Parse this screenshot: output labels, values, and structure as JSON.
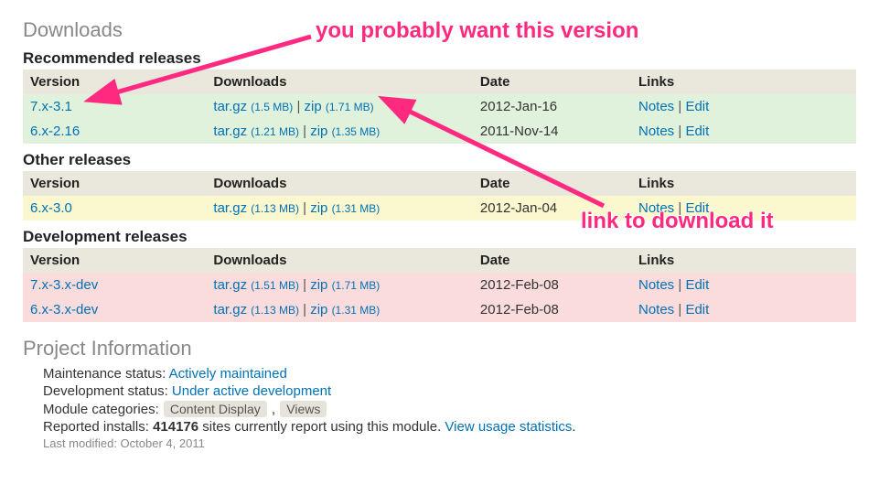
{
  "headings": {
    "downloads": "Downloads",
    "recommended": "Recommended releases",
    "other": "Other releases",
    "development": "Development releases",
    "project_info": "Project Information"
  },
  "columns": {
    "version": "Version",
    "downloads": "Downloads",
    "date": "Date",
    "links": "Links"
  },
  "separator": " | ",
  "links": {
    "notes": "Notes",
    "edit": "Edit"
  },
  "recommended": [
    {
      "version": "7.x-3.1",
      "tgz": "tar.gz",
      "tgz_size": "(1.5 MB)",
      "zip": "zip",
      "zip_size": "(1.71 MB)",
      "date": "2012-Jan-16"
    },
    {
      "version": "6.x-2.16",
      "tgz": "tar.gz",
      "tgz_size": "(1.21 MB)",
      "zip": "zip",
      "zip_size": "(1.35 MB)",
      "date": "2011-Nov-14"
    }
  ],
  "other": [
    {
      "version": "6.x-3.0",
      "tgz": "tar.gz",
      "tgz_size": "(1.13 MB)",
      "zip": "zip",
      "zip_size": "(1.31 MB)",
      "date": "2012-Jan-04"
    }
  ],
  "development": [
    {
      "version": "7.x-3.x-dev",
      "tgz": "tar.gz",
      "tgz_size": "(1.51 MB)",
      "zip": "zip",
      "zip_size": "(1.71 MB)",
      "date": "2012-Feb-08"
    },
    {
      "version": "6.x-3.x-dev",
      "tgz": "tar.gz",
      "tgz_size": "(1.13 MB)",
      "zip": "zip",
      "zip_size": "(1.31 MB)",
      "date": "2012-Feb-08"
    }
  ],
  "project": {
    "maintenance_label": "Maintenance status: ",
    "maintenance_value": "Actively maintained",
    "development_label": "Development status: ",
    "development_value": "Under active development",
    "categories_label": "Module categories: ",
    "cat1": "Content Display",
    "cat_sep": " , ",
    "cat2": "Views",
    "installs_label": "Reported installs: ",
    "installs_value": "414176",
    "installs_tail": " sites currently report using this module. ",
    "usage_link": "View usage statistics",
    "period": ".",
    "last_modified": "Last modified: October 4, 2011"
  },
  "annotations": {
    "version_hint": "you probably want this version",
    "download_hint": "link to download it"
  }
}
